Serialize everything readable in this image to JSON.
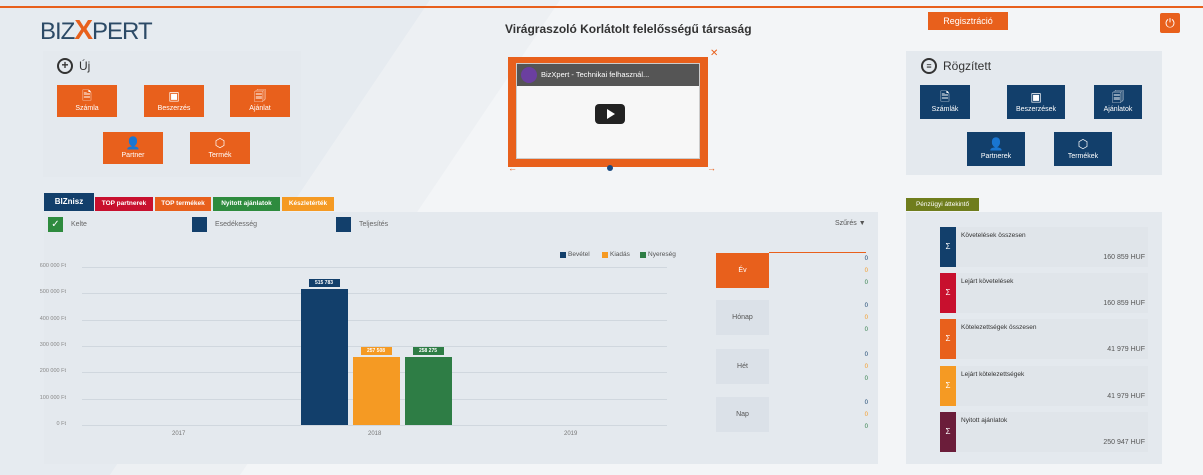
{
  "brand": {
    "logo_left": "BIZ",
    "logo_x": "X",
    "logo_right": "PERT"
  },
  "company_name": "Virágraszoló Korlátolt felelősségű társaság",
  "header": {
    "register_label": "Regisztráció",
    "power_icon": "power-icon"
  },
  "new_panel": {
    "title": "Új",
    "tiles": [
      {
        "label": "Számla",
        "icon": "invoice-add-icon",
        "glyph": "🗎"
      },
      {
        "label": "Beszerzés",
        "icon": "purchase-add-icon",
        "glyph": "▣"
      },
      {
        "label": "Ajánlat",
        "icon": "offer-add-icon",
        "glyph": "🗐"
      },
      {
        "label": "Partner",
        "icon": "partner-add-icon",
        "glyph": "👤"
      },
      {
        "label": "Termék",
        "icon": "product-add-icon",
        "glyph": "⬡"
      }
    ]
  },
  "video": {
    "title": "BizXpert - Technikai felhasznál..."
  },
  "saved_panel": {
    "title": "Rögzített",
    "tiles": [
      {
        "label": "Számlák",
        "icon": "invoices-icon",
        "glyph": "🗎"
      },
      {
        "label": "Beszerzések",
        "icon": "purchases-icon",
        "glyph": "▣"
      },
      {
        "label": "Ajánlatok",
        "icon": "offers-icon",
        "glyph": "🗐"
      },
      {
        "label": "Partnerek",
        "icon": "partners-icon",
        "glyph": "👤"
      },
      {
        "label": "Termékek",
        "icon": "products-icon",
        "glyph": "⬡"
      }
    ]
  },
  "tabs": [
    {
      "label": "BIZnisz",
      "color": "#123f6b"
    },
    {
      "label": "TOP partnerek",
      "color": "#c8102e"
    },
    {
      "label": "TOP termékek",
      "color": "#e8601c"
    },
    {
      "label": "Nyitott ajánlatok",
      "color": "#2e8b3e"
    },
    {
      "label": "Készletérték",
      "color": "#f59a23"
    }
  ],
  "date_types": {
    "issue": "Kelte",
    "due": "Esedékesség",
    "fulfil": "Teljesítés",
    "filter": "Szűrés"
  },
  "chart_data": {
    "type": "bar",
    "categories": [
      "2017",
      "2018",
      "2019"
    ],
    "series": [
      {
        "name": "Bevétel",
        "color": "#123f6b",
        "values": [
          0,
          515783,
          0
        ]
      },
      {
        "name": "Kiadás",
        "color": "#f59a23",
        "values": [
          0,
          257508,
          0
        ]
      },
      {
        "name": "Nyereség",
        "color": "#2e7d45",
        "values": [
          0,
          258275,
          0
        ]
      }
    ],
    "bar_labels": [
      "515 783",
      "257 508",
      "258 275"
    ],
    "yticks": [
      "0 Ft",
      "100 000 Ft",
      "200 000 Ft",
      "300 000 Ft",
      "400 000 Ft",
      "500 000 Ft",
      "600 000 Ft"
    ],
    "ylim": [
      0,
      600000
    ]
  },
  "periods": [
    {
      "label": "Év",
      "values": [
        "0",
        "0",
        "0"
      ]
    },
    {
      "label": "Hónap",
      "values": [
        "0",
        "0",
        "0"
      ]
    },
    {
      "label": "Hét",
      "values": [
        "0",
        "0",
        "0"
      ]
    },
    {
      "label": "Nap",
      "values": [
        "0",
        "0",
        "0"
      ]
    }
  ],
  "finance": {
    "title": "Pénzügyi áttekintő",
    "cards": [
      {
        "label": "Követelések összesen",
        "value": "160 859 HUF",
        "color": "#123f6b"
      },
      {
        "label": "Lejárt követelések",
        "value": "160 859 HUF",
        "color": "#c8102e"
      },
      {
        "label": "Kötelezettségek összesen",
        "value": "41 979 HUF",
        "color": "#e8601c"
      },
      {
        "label": "Lejárt kötelezettségek",
        "value": "41 979 HUF",
        "color": "#f59a23"
      },
      {
        "label": "Nyitott ajánlatok",
        "value": "250 947 HUF",
        "color": "#6b1d3a"
      }
    ],
    "sigma": "Σ"
  }
}
